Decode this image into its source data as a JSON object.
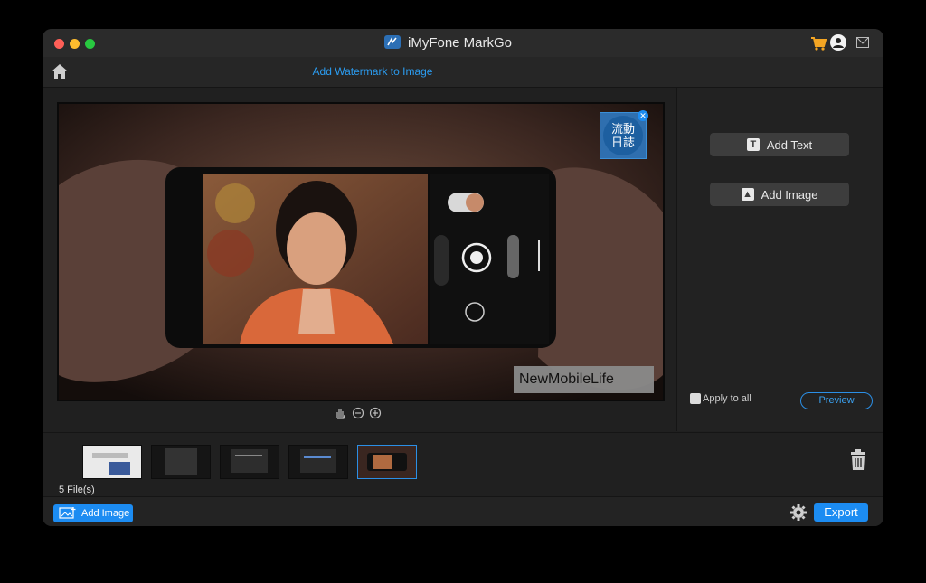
{
  "window": {
    "title": "iMyFone MarkGo"
  },
  "header": {
    "page_title": "Add Watermark to Image"
  },
  "panel": {
    "add_text_label": "Add Text",
    "add_image_label": "Add Image",
    "apply_to_all_label": "Apply to all",
    "apply_to_all_checked": false,
    "preview_label": "Preview"
  },
  "watermark": {
    "text": "NewMobileLife",
    "logo_text": "流動日誌"
  },
  "files": {
    "count_label": "5 File(s)",
    "selected_index": 4,
    "thumbnails": [
      "thumb-1",
      "thumb-2",
      "thumb-3",
      "thumb-4",
      "thumb-5"
    ]
  },
  "footer": {
    "add_image_label": "Add Image",
    "export_label": "Export"
  },
  "colors": {
    "accent": "#1c8cf2",
    "title_blue": "#2b9cf0",
    "background": "#202020"
  }
}
